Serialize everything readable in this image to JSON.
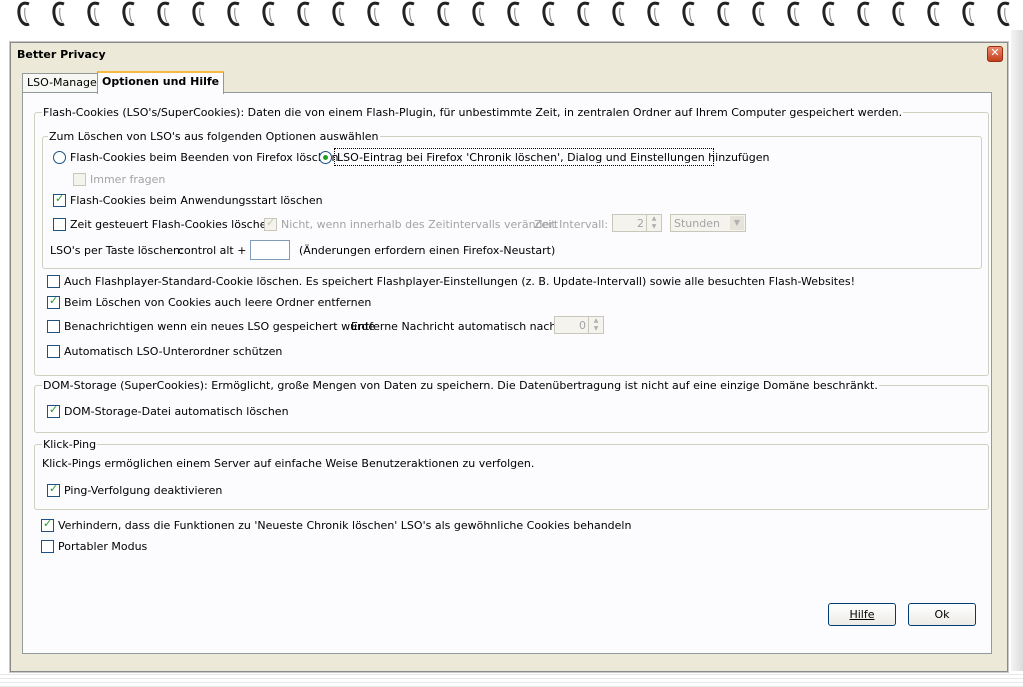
{
  "window": {
    "title": "Better Privacy"
  },
  "tabs": [
    {
      "label": "LSO-Manager",
      "active": false
    },
    {
      "label": "Optionen und Hilfe",
      "active": true
    }
  ],
  "flash": {
    "legend": "Flash-Cookies (LSO's/SuperCookies): Daten die von einem Flash-Plugin, für unbestimmte Zeit, in zentralen Ordner auf Ihrem Computer gespeichert werden.",
    "inner_legend": "Zum Löschen von LSO's aus folgenden Optionen auswählen",
    "radio_on_exit": {
      "label": "Flash-Cookies beim Beenden von Firefox löschen",
      "selected": false
    },
    "radio_history": {
      "label": "LSO-Eintrag bei Firefox 'Chronik löschen', Dialog und Einstellungen hinzufügen",
      "selected": true
    },
    "always_ask": {
      "label": "Immer fragen",
      "checked": false,
      "disabled": true
    },
    "on_start": {
      "label": "Flash-Cookies beim Anwendungsstart löschen",
      "checked": true
    },
    "timed": {
      "label": "Zeit gesteuert Flash-Cookies löschen",
      "checked": false
    },
    "not_changed": {
      "label": "Nicht, wenn innerhalb des Zeitintervalls verändert",
      "checked": true,
      "disabled": true
    },
    "interval_label": "Zeit Intervall:",
    "interval_value": "2",
    "interval_unit": "Stunden",
    "hotkey_label": "LSO's per Taste löschen:",
    "hotkey_mod": "control alt +",
    "hotkey_key": "",
    "hotkey_note": "(Änderungen erfordern einen Firefox-Neustart)",
    "std_cookie": {
      "label": "Auch Flashplayer-Standard-Cookie löschen. Es speichert Flashplayer-Einstellungen (z. B. Update-Intervall) sowie alle besuchten Flash-Websites!",
      "checked": false
    },
    "empty_folders": {
      "label": "Beim Löschen von Cookies auch leere Ordner entfernen",
      "checked": true
    },
    "notify": {
      "label": "Benachrichtigen wenn ein neues LSO gespeichert wurde",
      "checked": false
    },
    "notify_remove_label": "Entferne Nachricht automatisch nach [s]",
    "notify_remove_value": "0",
    "protect_sub": {
      "label": "Automatisch LSO-Unterordner schützen",
      "checked": false
    }
  },
  "dom": {
    "legend": "DOM-Storage (SuperCookies): Ermöglicht, große Mengen von Daten zu speichern. Die Datenübertragung ist nicht auf eine einzige Domäne beschränkt.",
    "auto_delete": {
      "label": "DOM-Storage-Datei automatisch löschen",
      "checked": true
    }
  },
  "ping": {
    "legend": "Klick-Ping",
    "description": "Klick-Pings ermöglichen einem Server auf einfache Weise Benutzeraktionen zu verfolgen.",
    "disable": {
      "label": "Ping-Verfolgung deaktivieren",
      "checked": true
    }
  },
  "prevent": {
    "label": "Verhindern, dass die Funktionen zu 'Neueste Chronik löschen' LSO's als gewöhnliche Cookies behandeln",
    "checked": true
  },
  "portable": {
    "label": "Portabler Modus",
    "checked": false
  },
  "buttons": {
    "help": "Hilfe",
    "ok": "Ok"
  },
  "icons": {
    "close": "close-icon",
    "check": "checkmark-icon",
    "spin_up": "spin-up-icon",
    "spin_down": "spin-down-icon",
    "dropdown": "chevron-down-icon"
  }
}
